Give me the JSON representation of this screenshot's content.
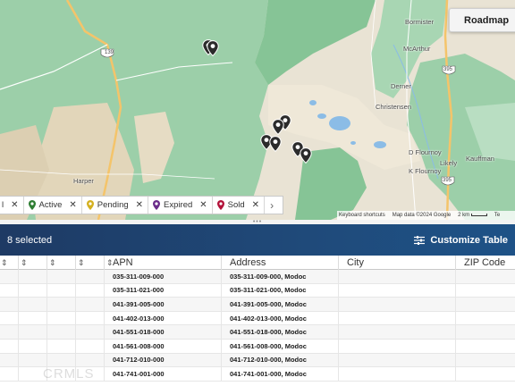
{
  "map": {
    "view_toggle": "Roadmap",
    "route_shields": [
      "139",
      "395",
      "395"
    ],
    "places": [
      "Bormister",
      "McArthur",
      "Derner",
      "Christensen",
      "D Flournoy",
      "K Flournoy",
      "Likely",
      "Kauffman",
      "Harper"
    ],
    "attribution": {
      "shortcuts": "Keyboard shortcuts",
      "copyright": "Map data ©2024 Google",
      "scale": "2 km",
      "terms": "Te"
    },
    "colors": {
      "forest": "#9ccfa9",
      "forest_dark": "#86c496",
      "land": "#e9e3d4",
      "field": "#dcd2bd",
      "water": "#8bbce6",
      "road": "#f4c46a"
    }
  },
  "legend": {
    "items": [
      {
        "label": "Active",
        "color": "#2e7d32"
      },
      {
        "label": "Pending",
        "color": "#d4b020"
      },
      {
        "label": "Expired",
        "color": "#6a2c8a"
      },
      {
        "label": "Sold",
        "color": "#b3123a"
      }
    ],
    "close_glyph": "✕",
    "next_glyph": "›"
  },
  "splitter": {
    "grip": "•••"
  },
  "results": {
    "selected_text": "8 selected",
    "customize_label": "Customize Table",
    "header_colors": [
      "#1e3a64",
      "#1e5287"
    ]
  },
  "table": {
    "sort_glyph": "⇕",
    "columns": [
      "APN",
      "Address",
      "City",
      "ZIP Code"
    ],
    "rows": [
      {
        "apn": "035-311-009-000",
        "address": "035-311-009-000, Modoc",
        "city": "",
        "zip": ""
      },
      {
        "apn": "035-311-021-000",
        "address": "035-311-021-000, Modoc",
        "city": "",
        "zip": ""
      },
      {
        "apn": "041-391-005-000",
        "address": "041-391-005-000, Modoc",
        "city": "",
        "zip": ""
      },
      {
        "apn": "041-402-013-000",
        "address": "041-402-013-000, Modoc",
        "city": "",
        "zip": ""
      },
      {
        "apn": "041-551-018-000",
        "address": "041-551-018-000, Modoc",
        "city": "",
        "zip": ""
      },
      {
        "apn": "041-561-008-000",
        "address": "041-561-008-000, Modoc",
        "city": "",
        "zip": ""
      },
      {
        "apn": "041-712-010-000",
        "address": "041-712-010-000, Modoc",
        "city": "",
        "zip": ""
      },
      {
        "apn": "041-741-001-000",
        "address": "041-741-001-000, Modoc",
        "city": "",
        "zip": ""
      }
    ]
  },
  "watermark": "CRMLS"
}
